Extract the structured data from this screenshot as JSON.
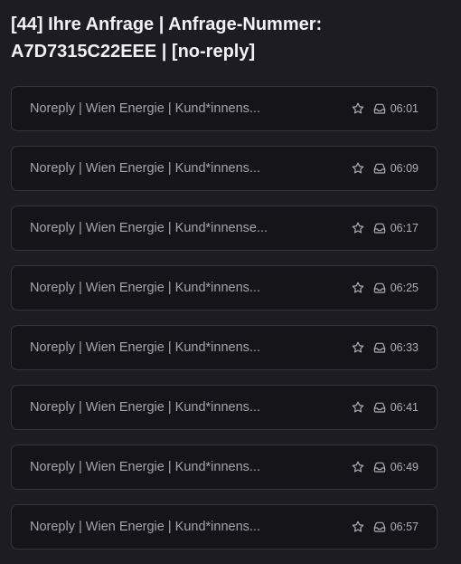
{
  "thread": {
    "title": "[44] Ihre Anfrage | Anfrage-Nummer: A7D7315C22EEE | [no-reply]"
  },
  "messages": [
    {
      "sender": "Noreply | Wien Energie | Kund*innens...",
      "time": "06:01"
    },
    {
      "sender": "Noreply | Wien Energie | Kund*innens...",
      "time": "06:09"
    },
    {
      "sender": "Noreply | Wien Energie | Kund*innense...",
      "time": "06:17"
    },
    {
      "sender": "Noreply | Wien Energie | Kund*innens...",
      "time": "06:25"
    },
    {
      "sender": "Noreply | Wien Energie | Kund*innens...",
      "time": "06:33"
    },
    {
      "sender": "Noreply | Wien Energie | Kund*innens...",
      "time": "06:41"
    },
    {
      "sender": "Noreply | Wien Energie | Kund*innens...",
      "time": "06:49"
    },
    {
      "sender": "Noreply | Wien Energie | Kund*innens...",
      "time": "06:57"
    }
  ],
  "icons": {
    "star": "star-icon",
    "inbox": "inbox-icon"
  }
}
